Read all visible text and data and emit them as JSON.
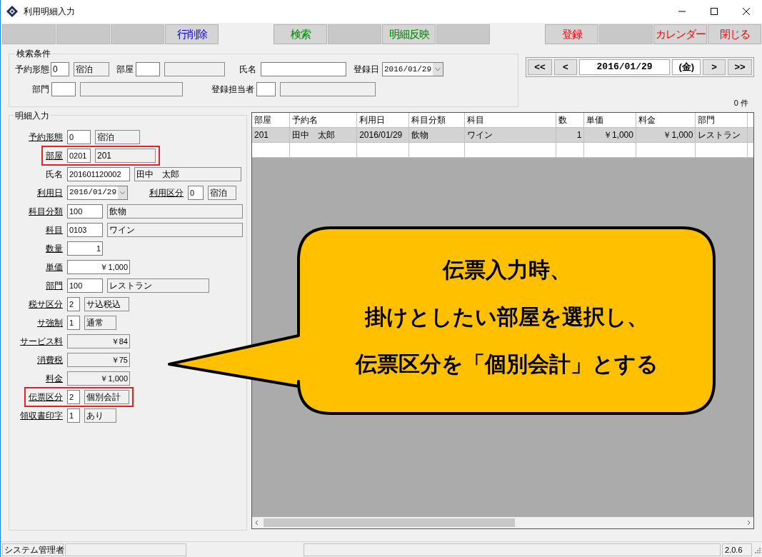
{
  "window": {
    "title": "利用明細入力"
  },
  "toolbar": [
    {
      "kind": "blank"
    },
    {
      "kind": "blank"
    },
    {
      "kind": "blank"
    },
    {
      "kind": "button",
      "label": "行削除",
      "color": "#0000ff"
    },
    {
      "kind": "spacer"
    },
    {
      "kind": "button",
      "label": "検索",
      "color": "#008000"
    },
    {
      "kind": "blank"
    },
    {
      "kind": "button",
      "label": "明細反映",
      "color": "#008000"
    },
    {
      "kind": "blank"
    },
    {
      "kind": "spacer"
    },
    {
      "kind": "button",
      "label": "登録",
      "color": "#ff0000"
    },
    {
      "kind": "blank"
    },
    {
      "kind": "button",
      "label": "カレンダー",
      "color": "#ff0000"
    },
    {
      "kind": "button",
      "label": "閉じる",
      "color": "#ff0000"
    }
  ],
  "search": {
    "title": "検索条件",
    "reservation_type_label": "予約形態",
    "reservation_type_code": "0",
    "reservation_type_name": "宿泊",
    "room_label": "部屋",
    "name_label": "氏名",
    "registered_date_label": "登録日",
    "registered_date": "2016/01/29",
    "department_label": "部門",
    "registrar_label": "登録担当者"
  },
  "date_nav": {
    "first": "<<",
    "prev": "<",
    "date": "2016/01/29",
    "weekday": "(金)",
    "next": ">",
    "last": ">>"
  },
  "count": "0 件",
  "detail": {
    "title": "明細入力",
    "fields": [
      {
        "label": "予約形態",
        "link": true,
        "highlighted": false,
        "code": "0",
        "name": "宿泊"
      },
      {
        "label": "部屋",
        "link": true,
        "highlighted": true,
        "code": "0201",
        "name": "201"
      },
      {
        "label": "氏名",
        "link": false,
        "highlighted": false,
        "code": "201601120002",
        "name": "田中　太郎"
      },
      {
        "label": "利用日",
        "link": true,
        "highlighted": false,
        "kind": "date",
        "code": "2016/01/29",
        "sub_label": "利用区分",
        "sub_code": "0",
        "name": "宿泊"
      },
      {
        "label": "科目分類",
        "link": true,
        "highlighted": false,
        "code": "100",
        "name": "飲物"
      },
      {
        "label": "科目",
        "link": true,
        "highlighted": false,
        "code": "0103",
        "name": "ワイン"
      },
      {
        "label": "数量",
        "link": true,
        "highlighted": false,
        "kind": "number",
        "code": "1"
      },
      {
        "label": "単価",
        "link": true,
        "highlighted": false,
        "kind": "number",
        "code": "￥1,000"
      },
      {
        "label": "部門",
        "link": true,
        "highlighted": false,
        "code": "100",
        "name": "レストラン"
      },
      {
        "label": "税サ区分",
        "link": true,
        "highlighted": false,
        "code": "2",
        "name": "サ込税込"
      },
      {
        "label": "サ強制",
        "link": true,
        "highlighted": false,
        "code": "1",
        "name": "通常"
      },
      {
        "label": "サービス料",
        "link": true,
        "highlighted": false,
        "kind": "amount",
        "code": "￥84"
      },
      {
        "label": "消費税",
        "link": true,
        "highlighted": false,
        "kind": "amount",
        "code": "￥75"
      },
      {
        "label": "料金",
        "link": true,
        "highlighted": false,
        "kind": "amount",
        "code": "￥1,000"
      },
      {
        "label": "伝票区分",
        "link": true,
        "highlighted": true,
        "code": "2",
        "name": "個別会計"
      },
      {
        "label": "領収書印字",
        "link": true,
        "highlighted": false,
        "code": "1",
        "name": "あり"
      }
    ]
  },
  "table": {
    "columns": [
      "部屋",
      "予約名",
      "利用日",
      "科目分類",
      "科目",
      "数",
      "単価",
      "料金",
      "部門"
    ],
    "rows": [
      {
        "selected": true,
        "cells": [
          "201",
          "田中　太郎",
          "2016/01/29",
          "飲物",
          "ワイン",
          "1",
          "￥1,000",
          "￥1,000",
          "レストラン"
        ]
      }
    ]
  },
  "callout": {
    "lines": [
      "伝票入力時、",
      "掛けとしたい部屋を選択し、",
      "伝票区分を「個別会計」とする"
    ]
  },
  "status_bar": {
    "user": "システム管理者",
    "version": "2.0.6"
  }
}
